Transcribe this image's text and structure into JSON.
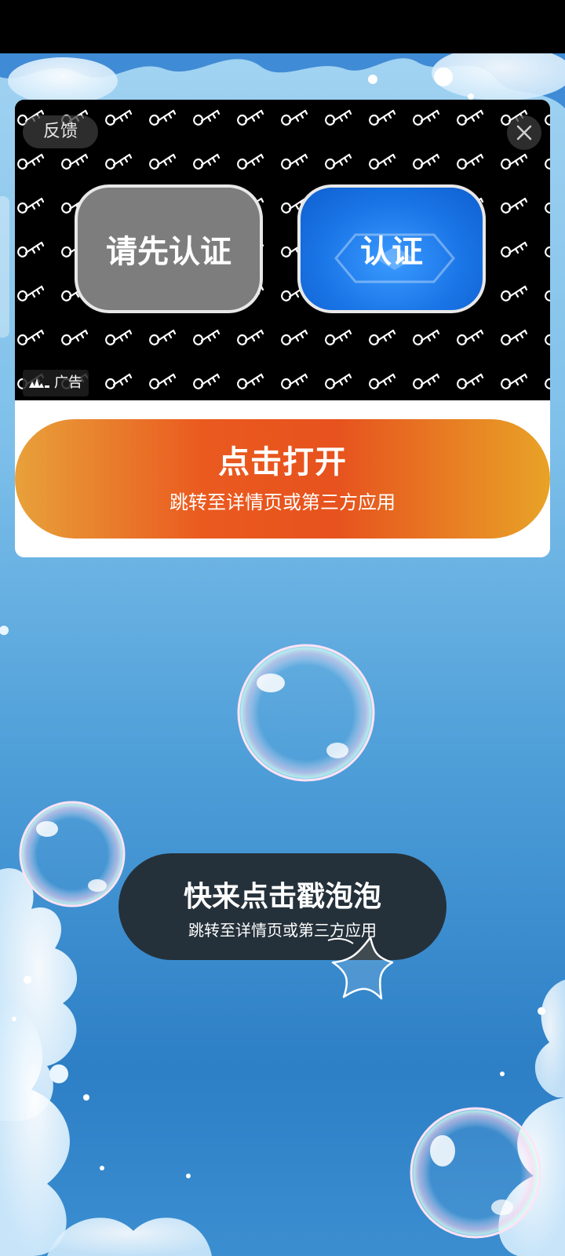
{
  "ad": {
    "feedback_label": "反馈",
    "ad_label": "广告",
    "left_button_label": "请先认证",
    "right_button_label": "认证",
    "open_title": "点击打开",
    "open_subtitle": "跳转至详情页或第三方应用"
  },
  "poke": {
    "title": "快来点击戳泡泡",
    "subtitle": "跳转至详情页或第三方应用"
  },
  "colors": {
    "status_bar": "#000000",
    "open_button_orange": "#ea5a1f",
    "pill_dark": "#25313a",
    "grey_button": "#7d7d7d",
    "blue_button": "#1a75e6"
  },
  "icons": {
    "close": "close-icon",
    "ad_logo": "ad-network-logo-icon",
    "star": "star-outline-icon",
    "bubble": "soap-bubble-icon"
  }
}
